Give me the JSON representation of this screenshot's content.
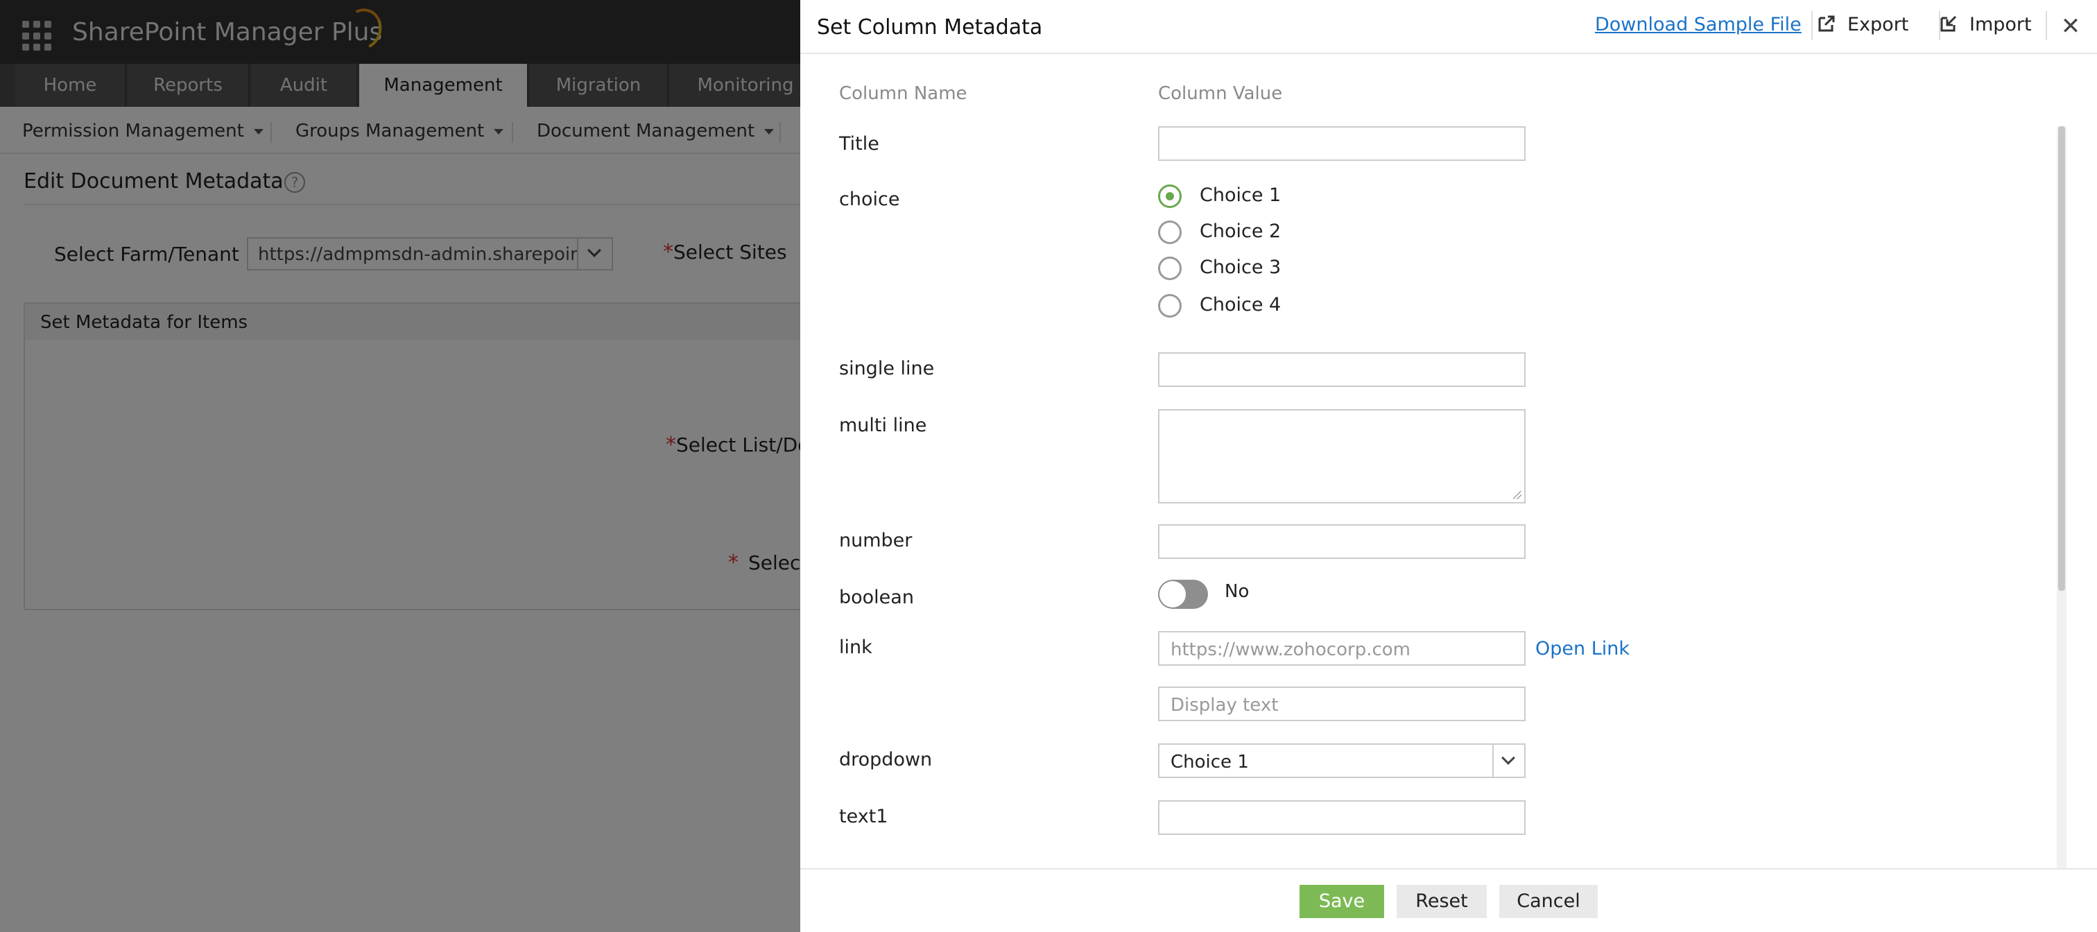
{
  "app": {
    "brand": "SharePoint Manager Plus",
    "nav_tabs": [
      {
        "label": "Home"
      },
      {
        "label": "Reports"
      },
      {
        "label": "Audit"
      },
      {
        "label": "Management",
        "active": true
      },
      {
        "label": "Migration"
      },
      {
        "label": "Monitoring"
      }
    ],
    "sub_menu": [
      {
        "label": "Permission Management"
      },
      {
        "label": "Groups Management"
      },
      {
        "label": "Document Management"
      }
    ],
    "page_title": "Edit Document Metadata",
    "help_glyph": "?",
    "farm_label": "Select Farm/Tenant",
    "farm_value": "https://admpmsdn-admin.sharepoint.com",
    "required_mark": "*",
    "sites_label": "Select Sites",
    "panel_title": "Set Metadata for Items",
    "list_label": "Select List/Doc",
    "select_label": "Select"
  },
  "modal": {
    "title": "Set Column Metadata",
    "download_link": "Download Sample File",
    "export_label": "Export",
    "import_label": "Import",
    "close_glyph": "✕",
    "column_name_header": "Column Name",
    "column_value_header": "Column Value",
    "fields": {
      "title_label": "Title",
      "choice_label": "choice",
      "choices": [
        "Choice 1",
        "Choice 2",
        "Choice 3",
        "Choice 4"
      ],
      "choice_selected": "Choice 1",
      "single_line_label": "single line",
      "multi_line_label": "multi line",
      "number_label": "number",
      "boolean_label": "boolean",
      "boolean_value": "No",
      "link_label": "link",
      "link_url_placeholder": "https://www.zohocorp.com",
      "link_text_placeholder": "Display text",
      "open_link": "Open Link",
      "dropdown_label": "dropdown",
      "dropdown_value": "Choice 1",
      "text1_label": "text1"
    },
    "buttons": {
      "save": "Save",
      "reset": "Reset",
      "cancel": "Cancel"
    }
  },
  "colors": {
    "accent_green": "#7dba55",
    "link_blue": "#1a73c8",
    "topbar": "#333333",
    "required_red": "#dd3333"
  }
}
